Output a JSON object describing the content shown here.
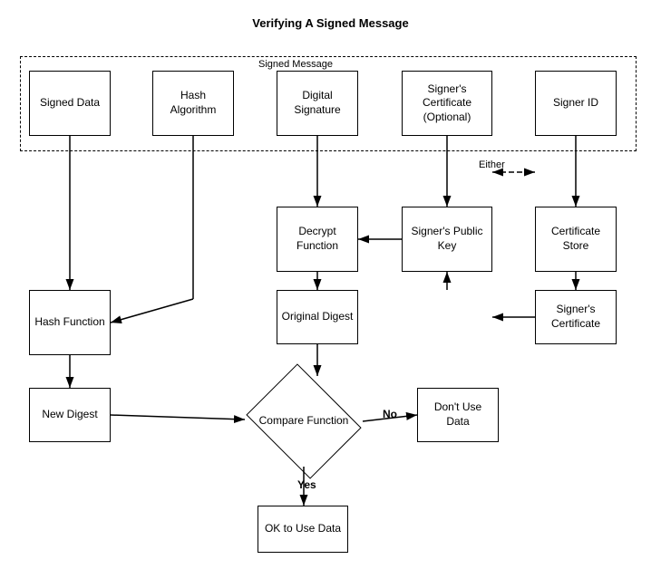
{
  "title": "Verifying A Signed Message",
  "boxes": {
    "signed_data": "Signed Data",
    "hash_algorithm": "Hash Algorithm",
    "digital_signature": "Digital Signature",
    "signers_certificate_optional": "Signer's Certificate (Optional)",
    "signer_id": "Signer ID",
    "decrypt_function": "Decrypt Function",
    "signers_public_key": "Signer's Public Key",
    "certificate_store": "Certificate Store",
    "hash_function": "Hash Function",
    "original_digest": "Original Digest",
    "signers_certificate": "Signer's Certificate",
    "new_digest": "New Digest",
    "compare_function": "Compare Function",
    "dont_use_data": "Don't Use Data",
    "ok_to_use_data": "OK to Use Data"
  },
  "labels": {
    "signed_message": "Signed Message",
    "either": "Either",
    "yes": "Yes",
    "no": "No"
  }
}
